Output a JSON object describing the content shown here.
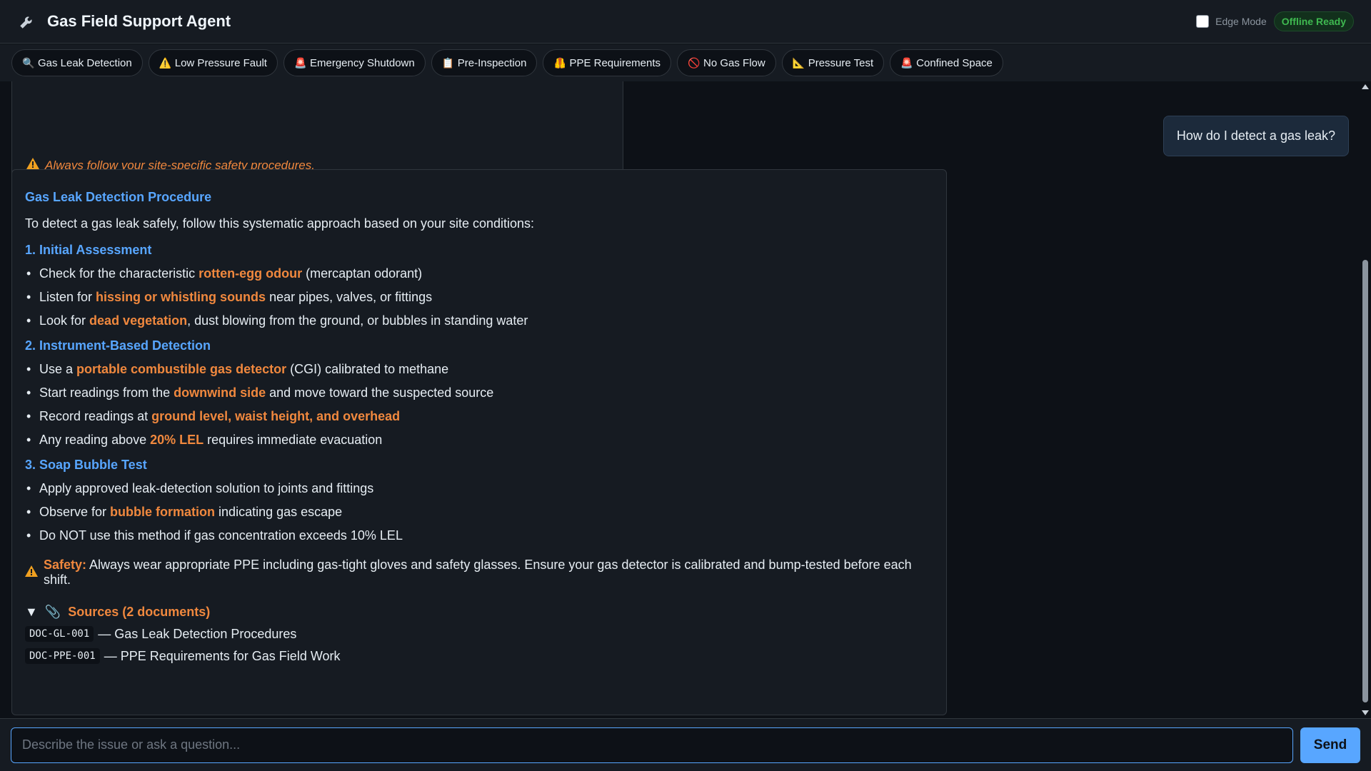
{
  "header": {
    "title": "Gas Field Support Agent",
    "edge_mode_label": "Edge Mode",
    "edge_mode_checked": false,
    "status_badge": "Offline Ready"
  },
  "quick_actions": [
    {
      "icon": "magnifier-icon",
      "glyph": "🔍",
      "label": "Gas Leak Detection"
    },
    {
      "icon": "warning-icon",
      "glyph": "⚠️",
      "label": "Low Pressure Fault"
    },
    {
      "icon": "siren-icon",
      "glyph": "🚨",
      "label": "Emergency Shutdown"
    },
    {
      "icon": "clipboard-icon",
      "glyph": "📋",
      "label": "Pre-Inspection"
    },
    {
      "icon": "vest-icon",
      "glyph": "🦺",
      "label": "PPE Requirements"
    },
    {
      "icon": "no-entry-icon",
      "glyph": "🚫",
      "label": "No Gas Flow"
    },
    {
      "icon": "ruler-icon",
      "glyph": "📐",
      "label": "Pressure Test"
    },
    {
      "icon": "alarm-light-icon",
      "glyph": "🚨",
      "label": "Confined Space"
    }
  ],
  "previous_message": {
    "note": "Always follow your site-specific safety procedures."
  },
  "user_message": "How do I detect a gas leak?",
  "answer": {
    "title": "Gas Leak Detection Procedure",
    "intro": "To detect a gas leak safely, follow this systematic approach based on your site conditions:",
    "sections": [
      {
        "heading": "1. Initial Assessment",
        "items": [
          {
            "pre": "Check for the characteristic ",
            "hl": "rotten-egg odour",
            "post": " (mercaptan odorant)"
          },
          {
            "pre": "Listen for ",
            "hl": "hissing or whistling sounds",
            "post": " near pipes, valves, or fittings"
          },
          {
            "pre": "Look for ",
            "hl": "dead vegetation",
            "post": ", dust blowing from the ground, or bubbles in standing water"
          }
        ]
      },
      {
        "heading": "2. Instrument-Based Detection",
        "items": [
          {
            "pre": "Use a ",
            "hl": "portable combustible gas detector",
            "post": " (CGI) calibrated to methane"
          },
          {
            "pre": "Start readings from the ",
            "hl": "downwind side",
            "post": " and move toward the suspected source"
          },
          {
            "pre": "Record readings at ",
            "hl": "ground level, waist height, and overhead",
            "post": ""
          },
          {
            "pre": "Any reading above ",
            "hl": "20% LEL",
            "post": " requires immediate evacuation"
          }
        ]
      },
      {
        "heading": "3. Soap Bubble Test",
        "items": [
          {
            "pre": "Apply approved leak-detection solution to joints and fittings",
            "hl": "",
            "post": ""
          },
          {
            "pre": "Observe for ",
            "hl": "bubble formation",
            "post": " indicating gas escape"
          },
          {
            "pre": "Do NOT use this method if gas concentration exceeds 10% LEL",
            "hl": "",
            "post": ""
          }
        ]
      }
    ],
    "safety_label": "Safety:",
    "safety_text": " Always wear appropriate PPE including gas-tight gloves and safety glasses. Ensure your gas detector is calibrated and bump-tested before each shift.",
    "sources_label": "Sources (2 documents)",
    "sources": [
      {
        "code": "DOC-GL-001",
        "title": " — Gas Leak Detection Procedures"
      },
      {
        "code": "DOC-PPE-001",
        "title": " — PPE Requirements for Gas Field Work"
      }
    ]
  },
  "composer": {
    "placeholder": "Describe the issue or ask a question...",
    "value": "",
    "send_label": "Send"
  },
  "colors": {
    "accent": "#58a6ff",
    "highlight": "#f0883e",
    "success": "#3fb950",
    "background": "#0d1117"
  }
}
